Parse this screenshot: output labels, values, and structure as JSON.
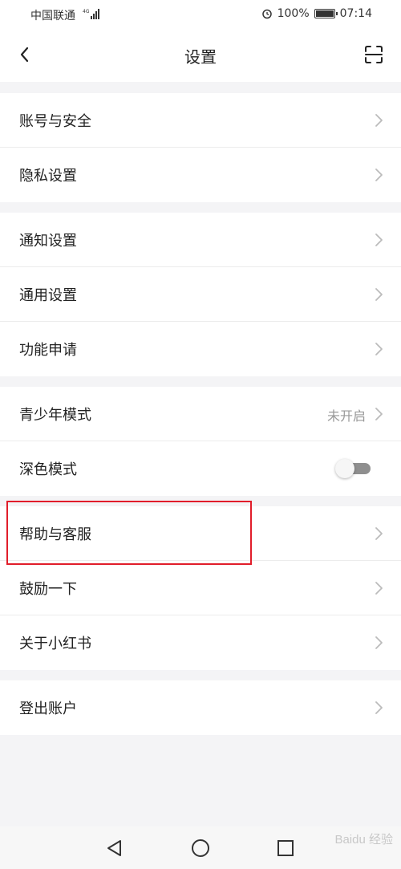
{
  "status_bar": {
    "carrier": "中国联通",
    "battery": "100%",
    "time": "07:14"
  },
  "header": {
    "title": "设置",
    "back_icon": "chevron-left-icon",
    "scan_icon": "scan-icon"
  },
  "groups": [
    {
      "items": [
        {
          "label": "账号与安全"
        },
        {
          "label": "隐私设置"
        }
      ]
    },
    {
      "items": [
        {
          "label": "通知设置"
        },
        {
          "label": "通用设置"
        },
        {
          "label": "功能申请"
        }
      ]
    },
    {
      "items": [
        {
          "label": "青少年模式",
          "value": "未开启"
        },
        {
          "label": "深色模式",
          "toggle": false
        }
      ]
    },
    {
      "items": [
        {
          "label": "帮助与客服"
        },
        {
          "label": "鼓励一下"
        },
        {
          "label": "关于小红书"
        }
      ]
    },
    {
      "items": [
        {
          "label": "登出账户"
        }
      ]
    }
  ],
  "annotation_color": "#e11d2a",
  "watermark": "Baidu 经验"
}
